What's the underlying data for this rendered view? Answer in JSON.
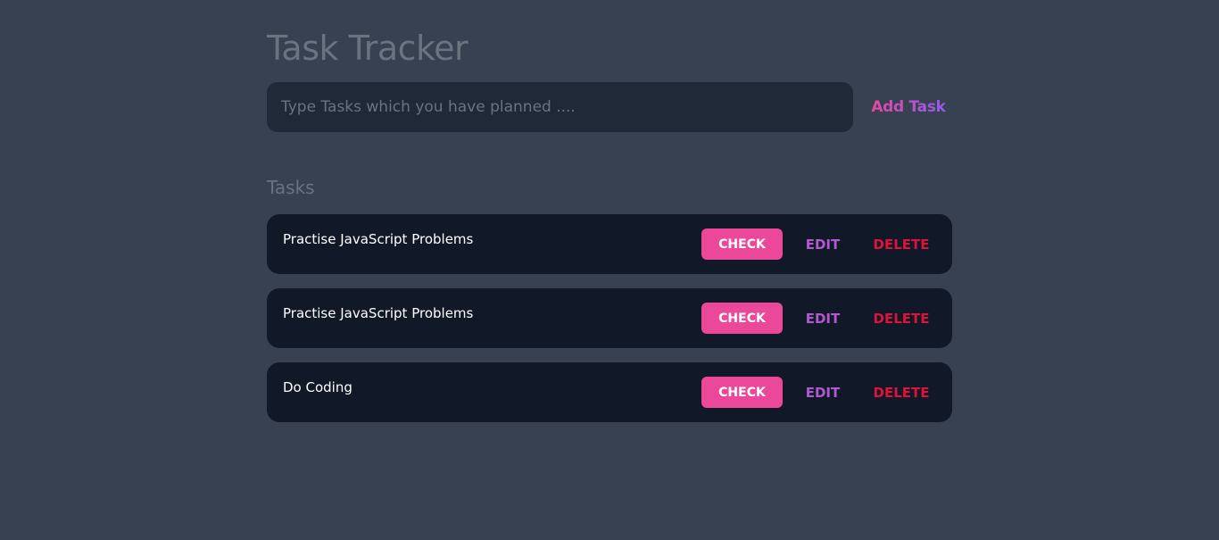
{
  "header": {
    "title": "Task Tracker"
  },
  "new_task": {
    "placeholder": "Type Tasks which you have planned ....",
    "value": "",
    "add_label": "Add Task"
  },
  "tasks_section": {
    "heading": "Tasks",
    "items": [
      {
        "text": "Practise JavaScript Problems",
        "check_label": "CHECK",
        "edit_label": "EDIT",
        "delete_label": "DELETE"
      },
      {
        "text": "Practise JavaScript Problems",
        "check_label": "CHECK",
        "edit_label": "EDIT",
        "delete_label": "DELETE"
      },
      {
        "text": "Do Coding",
        "check_label": "CHECK",
        "edit_label": "EDIT",
        "delete_label": "DELETE"
      }
    ]
  },
  "colors": {
    "background": "#374151",
    "input_background": "#1f2937",
    "task_background": "#111827",
    "muted_text": "#6b7280",
    "check_button": "#ec4899",
    "edit_text": "#b15ad0",
    "delete_text": "#dc143c",
    "add_gradient_start": "#ec4899",
    "add_gradient_end": "#8b5cf6"
  }
}
